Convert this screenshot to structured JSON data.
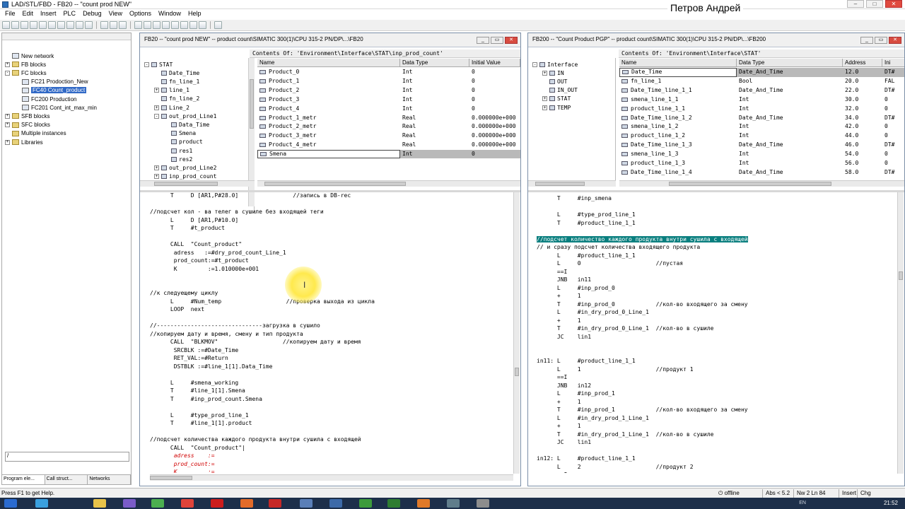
{
  "app": {
    "title": "LAD/STL/FBD - FB20 -- \"count prod NEW\"",
    "user_badge": "Петров Андрей"
  },
  "menu": [
    "File",
    "Edit",
    "Insert",
    "PLC",
    "Debug",
    "View",
    "Options",
    "Window",
    "Help"
  ],
  "explorer": {
    "items": [
      {
        "label": "New network",
        "indent": 0,
        "expander": "",
        "icon": "network-icon",
        "selected": false
      },
      {
        "label": "FB blocks",
        "indent": 0,
        "expander": "+",
        "icon": "folder-icon",
        "selected": false
      },
      {
        "label": "FC blocks",
        "indent": 0,
        "expander": "-",
        "icon": "folder-icon",
        "selected": false
      },
      {
        "label": "FC21  Prodoction_New",
        "indent": 1,
        "expander": "",
        "icon": "block-icon",
        "selected": false
      },
      {
        "label": "FC40  Count_product",
        "indent": 1,
        "expander": "",
        "icon": "block-icon",
        "selected": true
      },
      {
        "label": "FC200  Production",
        "indent": 1,
        "expander": "",
        "icon": "block-icon",
        "selected": false
      },
      {
        "label": "FC201  Cont_int_max_min",
        "indent": 1,
        "expander": "",
        "icon": "block-icon",
        "selected": false
      },
      {
        "label": "SFB blocks",
        "indent": 0,
        "expander": "+",
        "icon": "folder-icon",
        "selected": false
      },
      {
        "label": "SFC blocks",
        "indent": 0,
        "expander": "+",
        "icon": "folder-icon",
        "selected": false
      },
      {
        "label": "Multiple instances",
        "indent": 0,
        "expander": "",
        "icon": "folder-icon",
        "selected": false
      },
      {
        "label": "Libraries",
        "indent": 0,
        "expander": "+",
        "icon": "folder-icon",
        "selected": false
      }
    ],
    "input_value": "/",
    "tabs": [
      "Program ele...",
      "Call struct...",
      "Networks"
    ]
  },
  "fb20": {
    "title": "FB20 -- \"count prod NEW\" -- product count\\SIMATIC 300(1)\\CPU 315-2 PN/DP\\...\\FB20",
    "contents_header": "Contents Of: 'Environment\\Interface\\STAT\\inp_prod_count'",
    "tree": [
      {
        "label": "STAT",
        "indent": 0,
        "expander": "-"
      },
      {
        "label": "Date_Time",
        "indent": 1,
        "expander": ""
      },
      {
        "label": "fn_line_1",
        "indent": 1,
        "expander": ""
      },
      {
        "label": "line_1",
        "indent": 1,
        "expander": "+"
      },
      {
        "label": "fn_line_2",
        "indent": 1,
        "expander": ""
      },
      {
        "label": "Line_2",
        "indent": 1,
        "expander": "+"
      },
      {
        "label": "out_prod_Line1",
        "indent": 1,
        "expander": "-"
      },
      {
        "label": "Data_Time",
        "indent": 2,
        "expander": ""
      },
      {
        "label": "Smena",
        "indent": 2,
        "expander": ""
      },
      {
        "label": "product",
        "indent": 2,
        "expander": ""
      },
      {
        "label": "res1",
        "indent": 2,
        "expander": ""
      },
      {
        "label": "res2",
        "indent": 2,
        "expander": ""
      },
      {
        "label": "out_prod_Line2",
        "indent": 1,
        "expander": "+"
      },
      {
        "label": "inp_prod_count",
        "indent": 1,
        "expander": "+"
      }
    ],
    "columns": [
      "Name",
      "Data Type",
      "Initial Value"
    ],
    "rows": [
      [
        "Product_0",
        "Int",
        "0"
      ],
      [
        "Product_1",
        "Int",
        "0"
      ],
      [
        "Product_2",
        "Int",
        "0"
      ],
      [
        "Product_3",
        "Int",
        "0"
      ],
      [
        "Product_4",
        "Int",
        "0"
      ],
      [
        "Product_1_metr",
        "Real",
        "0.000000e+000"
      ],
      [
        "Product_2_metr",
        "Real",
        "0.000000e+000"
      ],
      [
        "Product_3_metr",
        "Real",
        "0.000000e+000"
      ],
      [
        "Product_4_metr",
        "Real",
        "0.000000e+000"
      ],
      [
        "Smena",
        "Int",
        "0"
      ]
    ],
    "highlighted_row": 9,
    "code": [
      {
        "t": "      T     D [AR1,P#28.0]                //запись в DB-rec",
        "c": ""
      },
      {
        "t": "",
        "c": ""
      },
      {
        "t": "//подсчет кол - ва телег в сушиле без входящей теги",
        "c": ""
      },
      {
        "t": "      L     D [AR1,P#10.0]",
        "c": ""
      },
      {
        "t": "      T     #t_product",
        "c": ""
      },
      {
        "t": "",
        "c": ""
      },
      {
        "t": "      CALL  \"Count_product\"",
        "c": ""
      },
      {
        "t": "       adress   :=#dry_prod_count_Line_1",
        "c": ""
      },
      {
        "t": "       prod_count:=#t_product",
        "c": ""
      },
      {
        "t": "       K         :=1.010000e+001",
        "c": ""
      },
      {
        "t": "",
        "c": ""
      },
      {
        "t": "",
        "c": ""
      },
      {
        "t": "//к следуещему циклу",
        "c": ""
      },
      {
        "t": "      L     #Num_temp                   //проверка выхода из цикла",
        "c": ""
      },
      {
        "t": "      LOOP  next",
        "c": ""
      },
      {
        "t": "",
        "c": ""
      },
      {
        "t": "//-------------------------------загрузка в сушило",
        "c": ""
      },
      {
        "t": "//копируем дату и время, смену и тип продукта",
        "c": ""
      },
      {
        "t": "      CALL  \"BLKMOV\"                   //копируем дату и время",
        "c": ""
      },
      {
        "t": "       SRCBLK :=#Date_Time",
        "c": ""
      },
      {
        "t": "       RET_VAL:=#Return",
        "c": ""
      },
      {
        "t": "       DSTBLK :=#line_1[1].Data_Time",
        "c": ""
      },
      {
        "t": "",
        "c": ""
      },
      {
        "t": "      L     #smena_working",
        "c": ""
      },
      {
        "t": "      T     #line_1[1].Smena",
        "c": ""
      },
      {
        "t": "      T     #inp_prod_count.Smena",
        "c": ""
      },
      {
        "t": "",
        "c": ""
      },
      {
        "t": "      L     #type_prod_line_1",
        "c": ""
      },
      {
        "t": "      T     #line_1[1].product",
        "c": ""
      },
      {
        "t": "",
        "c": ""
      },
      {
        "t": "//подсчет количества каждого продукта внутри сушила с входящей",
        "c": ""
      },
      {
        "t": "      CALL  \"Count_product\"|",
        "c": ""
      },
      {
        "t": "       adress    :=",
        "c": "red"
      },
      {
        "t": "       prod_count:=",
        "c": "red"
      },
      {
        "t": "       K         :=",
        "c": "red"
      }
    ]
  },
  "fb200": {
    "title": "FB200 -- \"Count Product PGP\" -- product count\\SIMATIC 300(1)\\CPU 315-2 PN/DP\\...\\FB200",
    "contents_header": "Contents Of: 'Environment\\Interface\\STAT'",
    "tree": [
      {
        "label": "Interface",
        "indent": 0,
        "expander": "-"
      },
      {
        "label": "IN",
        "indent": 1,
        "expander": "+"
      },
      {
        "label": "OUT",
        "indent": 1,
        "expander": ""
      },
      {
        "label": "IN_OUT",
        "indent": 1,
        "expander": ""
      },
      {
        "label": "STAT",
        "indent": 1,
        "expander": "+"
      },
      {
        "label": "TEMP",
        "indent": 1,
        "expander": "+"
      }
    ],
    "columns": [
      "Name",
      "Data Type",
      "Address",
      "Ini"
    ],
    "rows": [
      [
        "Date_Time",
        "Date_And_Time",
        "12.0",
        "DT#"
      ],
      [
        "fn_line_1",
        "Bool",
        "20.0",
        "FAL"
      ],
      [
        "Date_Time_line_1_1",
        "Date_And_Time",
        "22.0",
        "DT#"
      ],
      [
        "smena_line_1_1",
        "Int",
        "30.0",
        "0"
      ],
      [
        "product_line_1_1",
        "Int",
        "32.0",
        "0"
      ],
      [
        "Date_Time_line_1_2",
        "Date_And_Time",
        "34.0",
        "DT#"
      ],
      [
        "smena_line_1_2",
        "Int",
        "42.0",
        "0"
      ],
      [
        "product_line_1_2",
        "Int",
        "44.0",
        "0"
      ],
      [
        "Date_Time_line_1_3",
        "Date_And_Time",
        "46.0",
        "DT#"
      ],
      [
        "smena_line_1_3",
        "Int",
        "54.0",
        "0"
      ],
      [
        "product_line_1_3",
        "Int",
        "56.0",
        "0"
      ],
      [
        "Date_Time_line_1_4",
        "Date_And_Time",
        "58.0",
        "DT#"
      ],
      [
        "smena_line_1_4",
        "Int",
        "66.0",
        "0"
      ]
    ],
    "highlighted_row": 0,
    "code": [
      {
        "t": "      T     #inp_smena",
        "c": ""
      },
      {
        "t": "",
        "c": ""
      },
      {
        "t": "      L     #type_prod_line_1",
        "c": ""
      },
      {
        "t": "      T     #product_line_1_1",
        "c": ""
      },
      {
        "t": "",
        "c": ""
      },
      {
        "t": "//подсчет количество каждого продукта внутри сушила с входящей",
        "c": "hil"
      },
      {
        "t": "// и сразу подсчет количества входящего продукта",
        "c": ""
      },
      {
        "t": "      L     #product_line_1_1",
        "c": ""
      },
      {
        "t": "      L     0                      //пустая",
        "c": ""
      },
      {
        "t": "      ==I",
        "c": ""
      },
      {
        "t": "      JNB   in11",
        "c": ""
      },
      {
        "t": "      L     #inp_prod_0",
        "c": ""
      },
      {
        "t": "      +     1",
        "c": ""
      },
      {
        "t": "      T     #inp_prod_0            //кол-во входящего за смену",
        "c": ""
      },
      {
        "t": "      L     #in_dry_prod_0_Line_1",
        "c": ""
      },
      {
        "t": "      +     1",
        "c": ""
      },
      {
        "t": "      T     #in_dry_prod_0_Line_1  //кол-во в сушиле",
        "c": ""
      },
      {
        "t": "      JC    lin1",
        "c": ""
      },
      {
        "t": "",
        "c": ""
      },
      {
        "t": "",
        "c": ""
      },
      {
        "t": "in11: L     #product_line_1_1",
        "c": ""
      },
      {
        "t": "      L     1                      //продукт 1",
        "c": ""
      },
      {
        "t": "      ==I",
        "c": ""
      },
      {
        "t": "      JNB   in12",
        "c": ""
      },
      {
        "t": "      L     #inp_prod_1",
        "c": ""
      },
      {
        "t": "      +     1",
        "c": ""
      },
      {
        "t": "      T     #inp_prod_1            //кол-во входящего за смену",
        "c": ""
      },
      {
        "t": "      L     #in_dry_prod_1_Line_1",
        "c": ""
      },
      {
        "t": "      +     1",
        "c": ""
      },
      {
        "t": "      T     #in_dry_prod_1_Line_1  //кол-во в сушиле",
        "c": ""
      },
      {
        "t": "      JC    lin1",
        "c": ""
      },
      {
        "t": "",
        "c": ""
      },
      {
        "t": "in12: L     #product_line_1_1",
        "c": ""
      },
      {
        "t": "      L     2                      //продукт 2",
        "c": ""
      },
      {
        "t": "      ==I",
        "c": ""
      }
    ]
  },
  "status": {
    "hint": "Press F1 to get Help.",
    "mode": "offline",
    "abs": "Abs < 5.2",
    "nw": "Nw 2 Ln 84",
    "insert": "Insert",
    "chg": "Chg"
  },
  "taskbar": {
    "lang": "EN",
    "clock": "21:52"
  }
}
